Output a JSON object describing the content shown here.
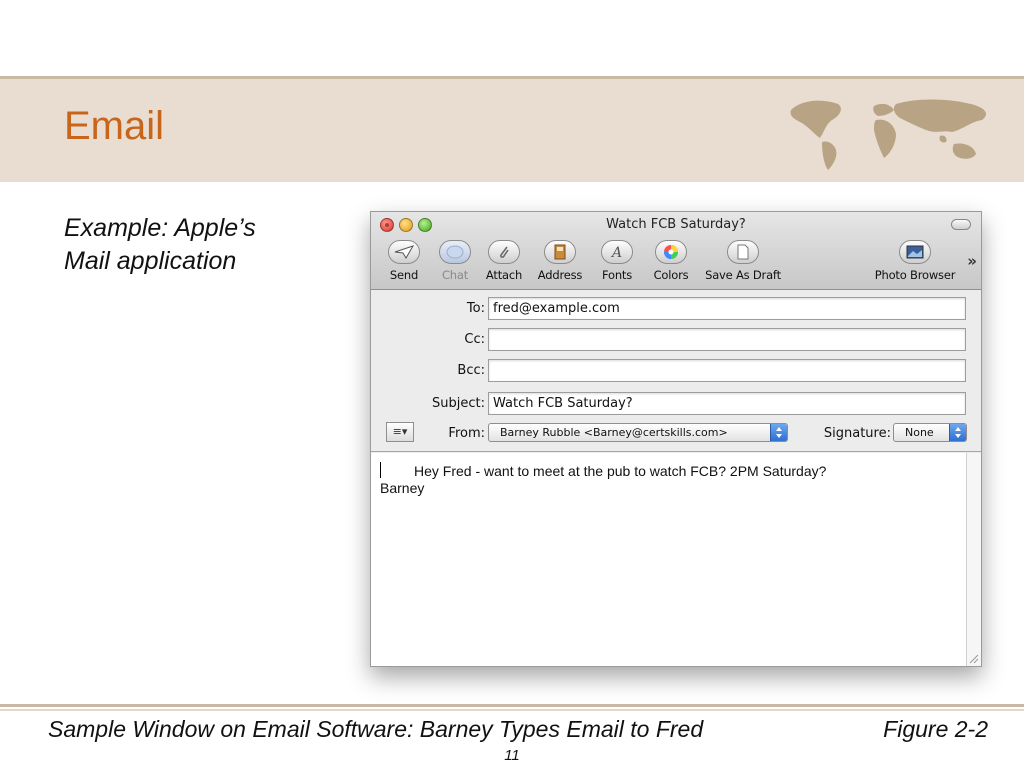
{
  "slide": {
    "title": "Email",
    "example_line1": "Example: Apple’s",
    "example_line2": "Mail application",
    "caption": "Sample Window on Email Software: Barney Types Email to Fred",
    "figure": "Figure 2-2",
    "page": "11",
    "colors": {
      "title": "#c8651b",
      "band": "#e8ddd0"
    }
  },
  "window": {
    "title": "Watch FCB Saturday?",
    "toolbar": {
      "send": "Send",
      "chat": "Chat",
      "attach": "Attach",
      "address": "Address",
      "fonts": "Fonts",
      "colors": "Colors",
      "save_as_draft": "Save As Draft",
      "photo_browser": "Photo Browser",
      "overflow": "»"
    },
    "fields": {
      "to_label": "To:",
      "to_value": "fred@example.com",
      "cc_label": "Cc:",
      "cc_value": "",
      "bcc_label": "Bcc:",
      "bcc_value": "",
      "subject_label": "Subject:",
      "subject_value": "Watch FCB Saturday?",
      "from_label": "From:",
      "from_value": "Barney Rubble <Barney@certskills.com>",
      "signature_label": "Signature:",
      "signature_value": "None",
      "options_button": "≡▾"
    },
    "body": {
      "line1": "Hey Fred - want to meet at the pub to watch FCB? 2PM Saturday?",
      "line2": "Barney"
    }
  }
}
